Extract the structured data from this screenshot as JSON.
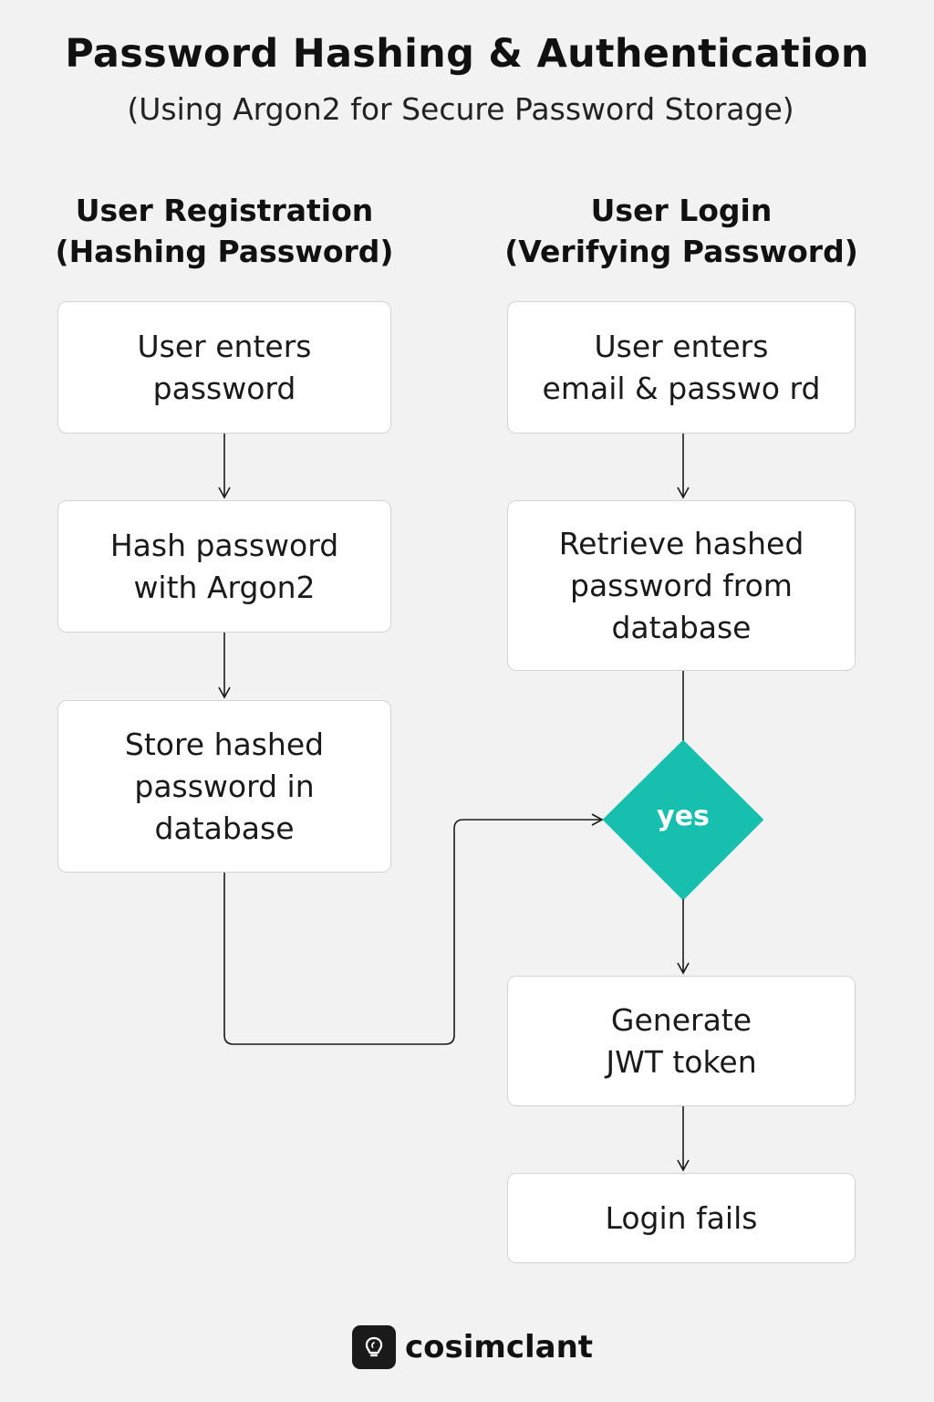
{
  "title": "Password Hashing & Authentication",
  "subtitle": "(Using Argon2 for Secure Password Storage)",
  "columns": {
    "registration": {
      "heading_line1": "User Registration",
      "heading_line2": "(Hashing Password)",
      "steps": [
        "User enters\npassword",
        "Hash password\nwith Argon2",
        "Store hashed\npassword in\ndatabase"
      ]
    },
    "login": {
      "heading_line1": "User Login",
      "heading_line2": "(Verifying Password)",
      "steps": [
        "User enters\nemail & passwo rd",
        "Retrieve hashed\npassword from\ndatabase"
      ],
      "decision_label": "yes",
      "after_decision": [
        "Generate\nJWT token",
        "Login fails"
      ]
    }
  },
  "brand": {
    "name": "cosimclant",
    "icon": "lightbulb-icon"
  },
  "colors": {
    "decision": "#17bfae",
    "background": "#f2f2f2",
    "box_border": "#d4d4d4"
  }
}
